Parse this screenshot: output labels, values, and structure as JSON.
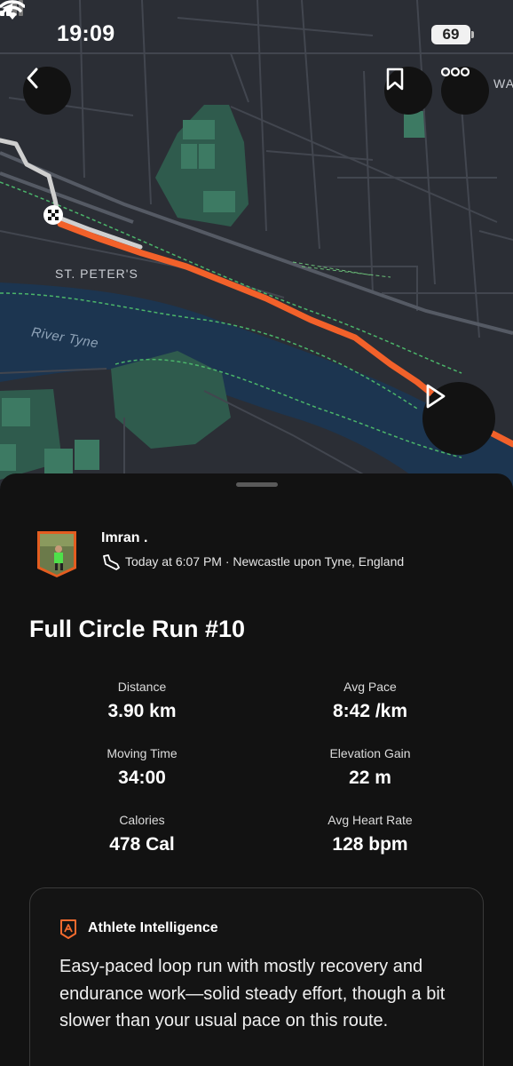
{
  "status_bar": {
    "time": "19:09",
    "battery": "69"
  },
  "map": {
    "labels": {
      "area": "ST. PETER'S",
      "river": "River Tyne",
      "edge": "WA"
    },
    "route_color": "#f2612a"
  },
  "activity": {
    "athlete_name": "Imran .",
    "meta": "Today at 6:07 PM · Newcastle upon Tyne, England",
    "title": "Full Circle Run #10",
    "stats": {
      "distance": {
        "label": "Distance",
        "value": "3.90 km"
      },
      "avg_pace": {
        "label": "Avg Pace",
        "value": "8:42 /km"
      },
      "moving_time": {
        "label": "Moving Time",
        "value": "34:00"
      },
      "elevation_gain": {
        "label": "Elevation Gain",
        "value": "22 m"
      },
      "calories": {
        "label": "Calories",
        "value": "478 Cal"
      },
      "avg_heart_rate": {
        "label": "Avg Heart Rate",
        "value": "128 bpm"
      }
    }
  },
  "athlete_intelligence": {
    "title": "Athlete Intelligence",
    "summary": "Easy-paced loop run with mostly recovery and endurance work—solid steady effort, though a bit slower than your usual pace on this route."
  },
  "colors": {
    "accent": "#fc5200",
    "background": "#121212",
    "map_bg": "#2b2e35",
    "park": "#2f5b4d",
    "river": "#1c3550"
  },
  "icons": [
    "location-arrow-icon",
    "cell-signal-icon",
    "wifi-icon",
    "back-chevron-icon",
    "bookmark-icon",
    "more-dots-icon",
    "play-icon",
    "checkered-flag-icon",
    "shoe-icon",
    "athlete-intelligence-icon"
  ]
}
